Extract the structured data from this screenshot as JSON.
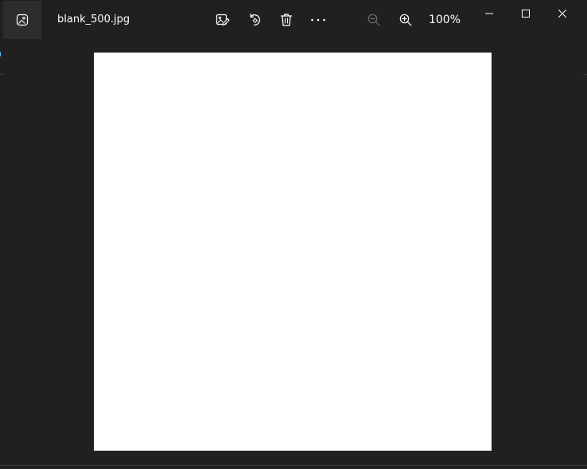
{
  "window": {
    "title": "blank_500.jpg",
    "zoom_level": "100%"
  },
  "toolbar": {
    "icons": [
      "edit-image-icon",
      "rotate-icon",
      "delete-icon",
      "more-icon",
      "zoom-out-icon",
      "zoom-in-icon"
    ],
    "zoom_out_enabled": false
  },
  "controls": {
    "icons": [
      "minimize-icon",
      "maximize-icon",
      "close-icon"
    ]
  },
  "colors": {
    "background": "#202020",
    "app_icon_bg": "#2d2d2d",
    "image": "#ffffff",
    "accent": "#4cc2ff",
    "icon": "#ffffff",
    "icon_disabled": "#6e6e6e"
  }
}
